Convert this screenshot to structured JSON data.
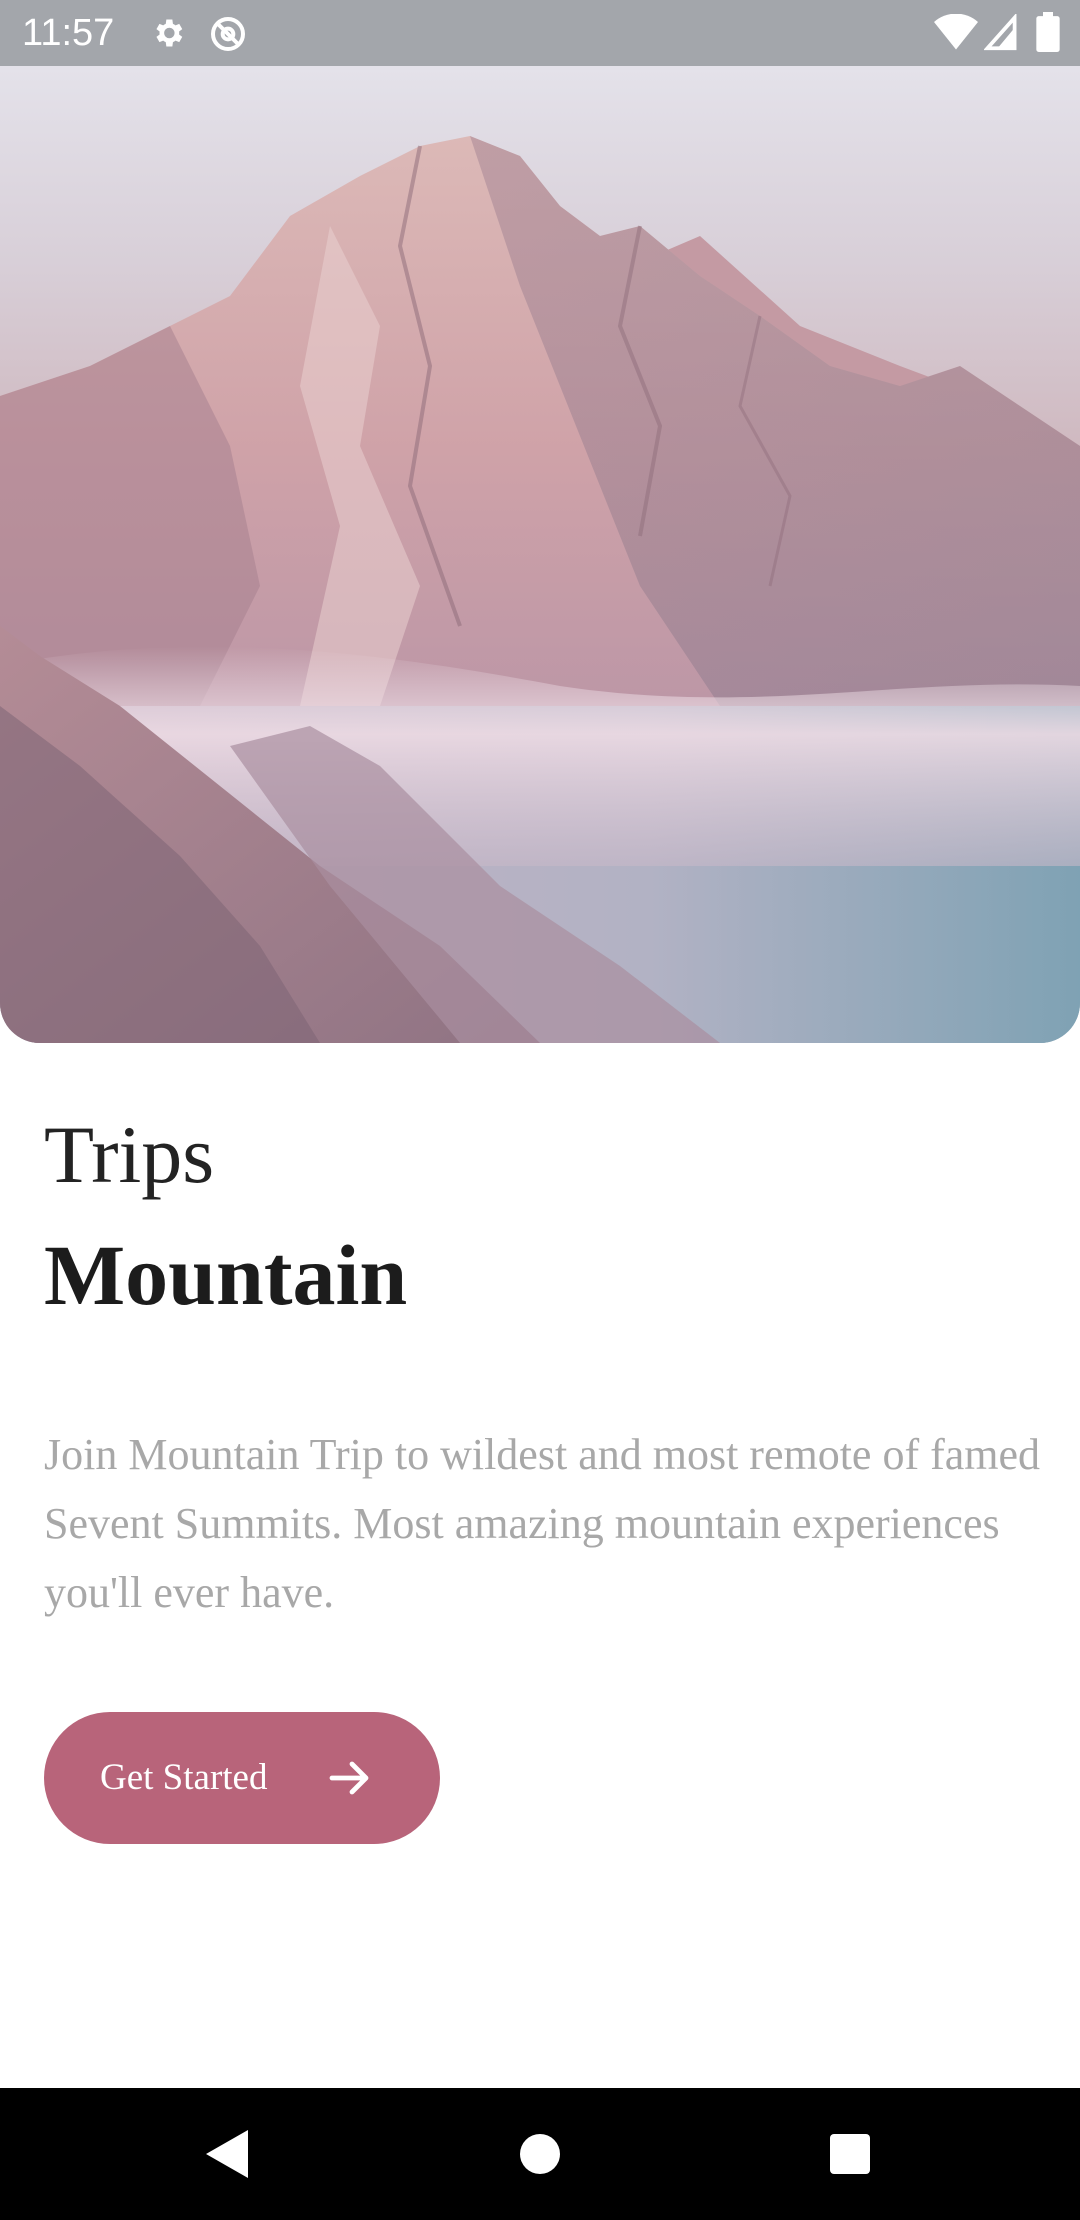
{
  "status_bar": {
    "time": "11:57",
    "icons": [
      "gear-icon",
      "at-sign-icon",
      "wifi-icon",
      "cell-signal-icon",
      "battery-icon"
    ]
  },
  "hero": {
    "image": "mountain-peak-misty-photo"
  },
  "content": {
    "title_light": "Trips",
    "title_bold": "Mountain",
    "description": "Join Mountain Trip to wildest and most remote of famed Sevent Summits. Most amazing mountain experiences you'll ever have."
  },
  "cta": {
    "label": "Get Started",
    "icon": "arrow-right-icon",
    "color": "#b8647a"
  },
  "nav_bar": {
    "buttons": [
      "back-icon",
      "home-icon",
      "recents-icon"
    ]
  }
}
